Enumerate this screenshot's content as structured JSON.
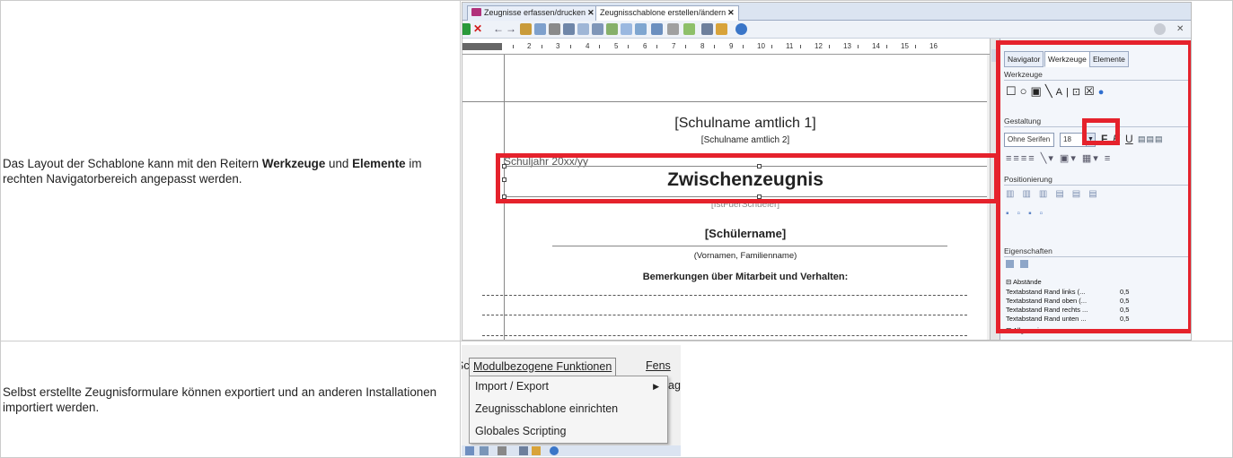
{
  "rows": [
    {
      "description_parts": [
        "Das Layout der Schablone kann mit den Reitern ",
        "Werkzeuge",
        " und ",
        "Elemente",
        " im rechten Navigatorbereich angepasst werden."
      ]
    },
    {
      "description": "Selbst erstellte Zeugnisformulare können exportiert und an anderen Installationen importiert werden."
    }
  ],
  "shot1": {
    "tabs": [
      "Zeugnisse erfassen/drucken",
      "Zeugnisschablone erstellen/ändern"
    ],
    "close_glyph": "✕",
    "ruler_numbers": [
      "2",
      "3",
      "4",
      "5",
      "6",
      "7",
      "8",
      "9",
      "10",
      "11",
      "12",
      "13",
      "14",
      "15",
      "16"
    ],
    "page": {
      "school_name_1": "[Schulname amtlich 1]",
      "school_name_2": "[Schulname amtlich 2]",
      "school_year": "Schuljahr 20xx/yy",
      "title": "Zwischenzeugnis",
      "school_year_overlap": "[IstFuerSchueler]",
      "student_name": "[Schülername]",
      "student_name_hint": "(Vornamen, Familienname)",
      "remarks": "Bemerkungen über Mitarbeit und Verhalten:"
    },
    "panel": {
      "tabs": [
        "Navigator",
        "Werkzeuge",
        "Elemente"
      ],
      "groups": {
        "werkzeuge": "Werkzeuge",
        "gestaltung": "Gestaltung",
        "positionierung": "Positionierung",
        "eigenschaften": "Eigenschaften"
      },
      "font_name": "Ohne Serifen",
      "font_size": "18",
      "format_buttons": [
        "F",
        "K",
        "U"
      ],
      "sections": {
        "abstaende": "Abstände",
        "allgemein": "Allgemein"
      },
      "properties": [
        {
          "name": "Textabstand Rand links (...",
          "value": "0,5"
        },
        {
          "name": "Textabstand Rand oben (...",
          "value": "0,5"
        },
        {
          "name": "Textabstand Rand rechts ...",
          "value": "0,5"
        },
        {
          "name": "Textabstand Rand unten ...",
          "value": "0,5"
        }
      ]
    },
    "colors": {
      "highlight": "#e5222c"
    }
  },
  "shot2": {
    "menubar": {
      "open_menu": "Modulbezogene Funktionen",
      "next_menu": "Fens",
      "left_fragment": "Sc",
      "right_fragment": "ag"
    },
    "menu_items": [
      {
        "label": "Import / Export",
        "has_submenu": true
      },
      {
        "label": "Zeugnisschablone einrichten"
      },
      {
        "label": "Globales Scripting"
      }
    ],
    "submenu_arrow": "▶"
  }
}
